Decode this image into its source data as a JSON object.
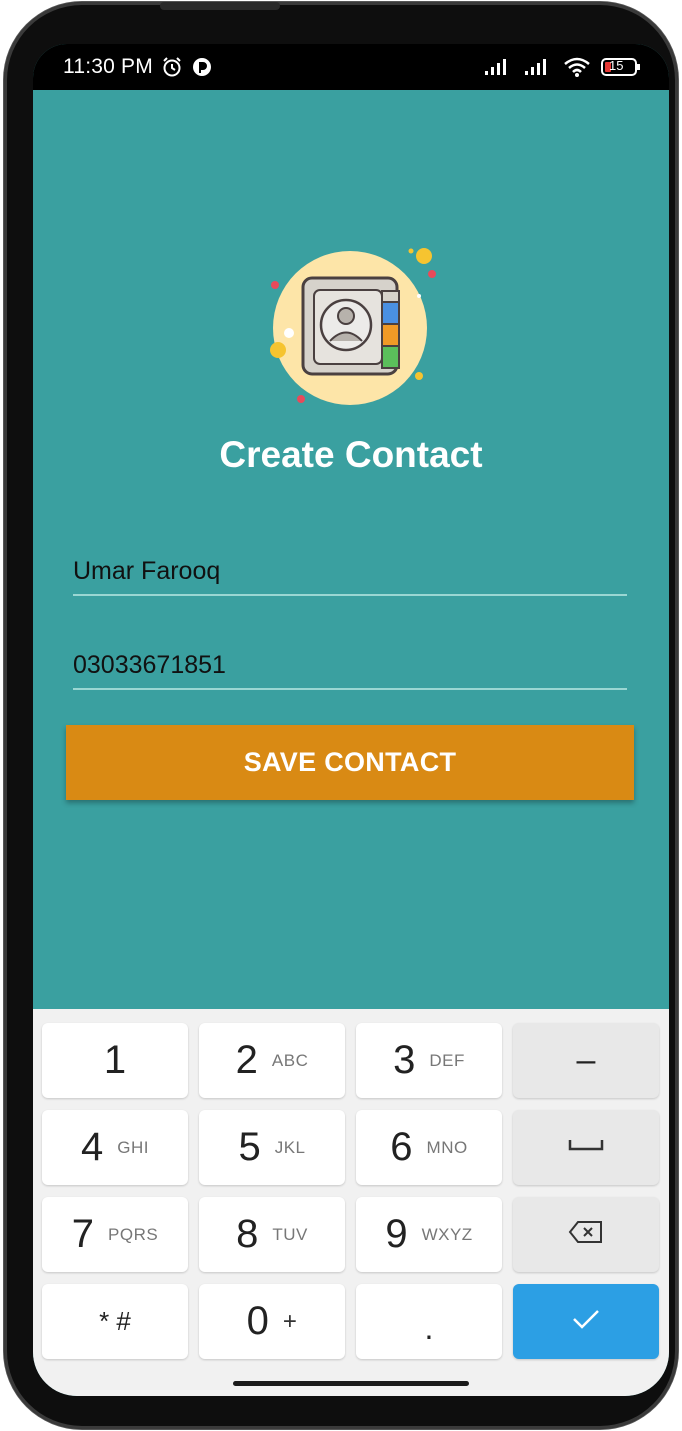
{
  "status_bar": {
    "time": "11:30 PM",
    "battery": "15"
  },
  "app": {
    "title": "Create Contact",
    "logo_icon": "contact-book-icon"
  },
  "form": {
    "name_value": "Umar Farooq",
    "phone_value": "03033671851",
    "save_label": "SAVE CONTACT"
  },
  "keypad": {
    "keys": [
      {
        "digit": "1",
        "letters": ""
      },
      {
        "digit": "2",
        "letters": "ABC"
      },
      {
        "digit": "3",
        "letters": "DEF"
      },
      {
        "digit": "4",
        "letters": "GHI"
      },
      {
        "digit": "5",
        "letters": "JKL"
      },
      {
        "digit": "6",
        "letters": "MNO"
      },
      {
        "digit": "7",
        "letters": "PQRS"
      },
      {
        "digit": "8",
        "letters": "TUV"
      },
      {
        "digit": "9",
        "letters": "WXYZ"
      },
      {
        "digit": "0",
        "letters": "+"
      }
    ],
    "symbols_key": "* #",
    "dot_key": ".",
    "minus_key": "–"
  },
  "colors": {
    "background": "#3aa0a0",
    "accent": "#d98a14",
    "done_key": "#2c9fe4"
  }
}
